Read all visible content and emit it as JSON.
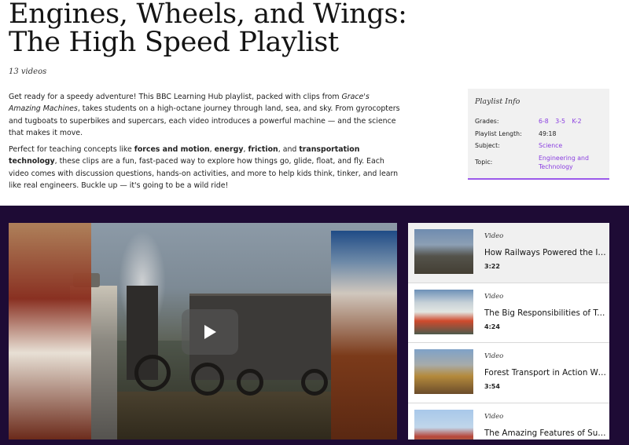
{
  "header": {
    "title": "Engines, Wheels, and Wings: The High Speed Playlist",
    "video_count": "13 videos"
  },
  "description": {
    "p1_a": "Get ready for a speedy adventure! This BBC Learning Hub playlist, packed with clips from ",
    "p1_em": "Grace's Amazing Machines",
    "p1_b": ", takes students on a high-octane journey through land, sea, and sky. From gyrocopters and tugboats to superbikes and supercars, each video introduces a powerful machine — and the science that makes it move.",
    "p2_a": "Perfect for teaching concepts like ",
    "p2_b1": "forces and motion",
    "p2_c": ", ",
    "p2_b2": "energy",
    "p2_d": ", ",
    "p2_b3": "friction",
    "p2_e": ", and ",
    "p2_b4": "transportation technology",
    "p2_f": ", these clips are a fun, fast-paced way to explore how things go, glide, float, and fly. Each video comes with discussion questions, hands-on activities, and more to help kids think, tinker, and learn like real engineers. Buckle up — it's going to be a wild ride!"
  },
  "playlist_info": {
    "heading": "Playlist Info",
    "grades_label": "Grades:",
    "grades": [
      "6-8",
      "3-5",
      "K-2"
    ],
    "length_label": "Playlist Length:",
    "length": "49:18",
    "subject_label": "Subject:",
    "subject": "Science",
    "topic_label": "Topic:",
    "topic": "Engineering and Technology",
    "accent_color": "#9b59ea"
  },
  "player": {
    "play_icon": "play-icon",
    "band_color": "#1e0b35"
  },
  "playlist": [
    {
      "kind": "Video",
      "title": "How Railways Powered the In...",
      "duration": "3:22",
      "active": true
    },
    {
      "kind": "Video",
      "title": "The Big Responsibilities of Tu...",
      "duration": "4:24",
      "active": false
    },
    {
      "kind": "Video",
      "title": "Forest Transport in Action Wi...",
      "duration": "3:54",
      "active": false
    },
    {
      "kind": "Video",
      "title": "The Amazing Features of Sup...",
      "duration": "",
      "active": false
    }
  ]
}
